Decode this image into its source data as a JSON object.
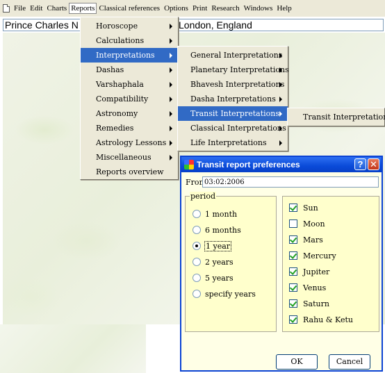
{
  "menubar": {
    "items": [
      "File",
      "Edit",
      "Charts",
      "Reports",
      "Classical references",
      "Options",
      "Print",
      "Research",
      "Windows",
      "Help"
    ],
    "active": "Reports"
  },
  "chart_title": {
    "left": "Prince Charles N",
    "right": "London, England"
  },
  "reports_menu": {
    "items": [
      {
        "label": "Horoscope",
        "submenu": true
      },
      {
        "label": "Calculations",
        "submenu": true
      },
      {
        "label": "Interpretations",
        "submenu": true,
        "selected": true
      },
      {
        "label": "Dashas",
        "submenu": true
      },
      {
        "label": "Varshaphala",
        "submenu": true
      },
      {
        "label": "Compatibility",
        "submenu": true
      },
      {
        "label": "Astronomy",
        "submenu": true
      },
      {
        "label": "Remedies",
        "submenu": true
      },
      {
        "label": "Astrology Lessons",
        "submenu": true
      },
      {
        "label": "Miscellaneous",
        "submenu": true
      },
      {
        "label": "Reports overview",
        "submenu": false
      }
    ]
  },
  "interpretations_menu": {
    "items": [
      {
        "label": "General Interpretations",
        "submenu": true
      },
      {
        "label": "Planetary Interpretations",
        "submenu": true
      },
      {
        "label": "Bhavesh Interpretations",
        "submenu": true
      },
      {
        "label": "Dasha Interpretations",
        "submenu": true
      },
      {
        "label": "Transit Interpretations",
        "submenu": true,
        "selected": true
      },
      {
        "label": "Classical Interpretations",
        "submenu": true
      },
      {
        "label": "Life Interpretations",
        "submenu": true
      }
    ]
  },
  "transit_menu": {
    "items": [
      {
        "label": "Transit Interpretations"
      }
    ]
  },
  "dialog": {
    "title": "Transit report preferences",
    "help_label": "?",
    "close_label": "✕",
    "from_label": "From",
    "from_value": "03:02:2006",
    "period_legend": "period",
    "period_options": [
      {
        "label": "1 month",
        "selected": false
      },
      {
        "label": "6 months",
        "selected": false
      },
      {
        "label": "1 year",
        "selected": true
      },
      {
        "label": "2 years",
        "selected": false
      },
      {
        "label": "5 years",
        "selected": false
      },
      {
        "label": "specify years",
        "selected": false
      }
    ],
    "planets": [
      {
        "label": "Sun",
        "checked": true
      },
      {
        "label": "Moon",
        "checked": false
      },
      {
        "label": "Mars",
        "checked": true
      },
      {
        "label": "Mercury",
        "checked": true
      },
      {
        "label": "Jupiter",
        "checked": true
      },
      {
        "label": "Venus",
        "checked": true
      },
      {
        "label": "Saturn",
        "checked": true
      },
      {
        "label": "Rahu & Ketu",
        "checked": true
      }
    ],
    "ok_label": "OK",
    "cancel_label": "Cancel"
  },
  "colors": {
    "menu_bg": "#ece9d8",
    "selection": "#316ac5",
    "dialog_bg": "#ffffe6",
    "titlebar": "#0a4ad8"
  }
}
